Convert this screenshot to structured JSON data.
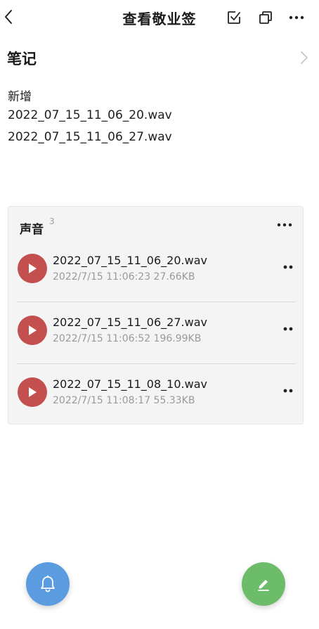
{
  "header": {
    "title": "查看敬业签",
    "icons": [
      "chevron-left-icon",
      "checkbox-icon",
      "copy-icon",
      "more-icon"
    ]
  },
  "note": {
    "section_title": "笔记",
    "lines": [
      "新增",
      "2022_07_15_11_06_20.wav",
      "2022_07_15_11_06_27.wav"
    ]
  },
  "audio": {
    "title": "声音",
    "count": "3",
    "items": [
      {
        "name": "2022_07_15_11_06_20.wav",
        "meta": "2022/7/15 11:06:23  27.66KB"
      },
      {
        "name": "2022_07_15_11_06_27.wav",
        "meta": "2022/7/15 11:06:52  196.99KB"
      },
      {
        "name": "2022_07_15_11_08_10.wav",
        "meta": "2022/7/15 11:08:17  55.33KB"
      }
    ]
  },
  "colors": {
    "play": "#c3504e",
    "bell_fab": "#5b9be0",
    "edit_fab": "#6cbc6a"
  }
}
